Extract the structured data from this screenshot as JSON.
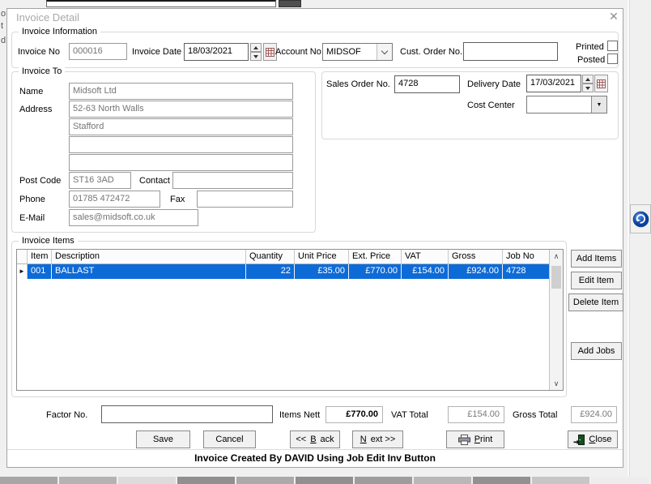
{
  "window": {
    "title": "Invoice Detail"
  },
  "icons": {
    "close": "✕",
    "row_selector": "►",
    "dropdown_arrow": "▼",
    "scroll_up": "∧",
    "scroll_down": "∨"
  },
  "colors": {
    "selection_blue": "#0d6bd8",
    "calendar_icon_brown": "#9d5b5b",
    "door_icon_green": "#17501c"
  },
  "background": {
    "clipped_letters": [
      "o",
      "t",
      "d"
    ]
  },
  "invoice_information": {
    "group_label": "Invoice Information",
    "invoice_no_label": "Invoice No",
    "invoice_no": "000016",
    "invoice_date_label": "Invoice Date",
    "invoice_date": "18/03/2021",
    "account_no_label": "Account No.",
    "account_no": "MIDSOF",
    "cust_order_no_label": "Cust. Order No.",
    "cust_order_no": "",
    "printed_label": "Printed",
    "printed_checked": false,
    "posted_label": "Posted",
    "posted_checked": false
  },
  "invoice_to": {
    "group_label": "Invoice To",
    "name_label": "Name",
    "name": "Midsoft Ltd",
    "address_label": "Address",
    "address_lines": [
      "52-63 North Walls",
      "Stafford",
      "",
      ""
    ],
    "post_code_label": "Post Code",
    "post_code": "ST16 3AD",
    "contact_label": "Contact",
    "contact": "",
    "phone_label": "Phone",
    "phone": "01785 472472",
    "fax_label": "Fax",
    "fax": "",
    "email_label": "E-Mail",
    "email": "sales@midsoft.co.uk"
  },
  "order_details": {
    "sales_order_no_label": "Sales Order No.",
    "sales_order_no": "4728",
    "delivery_date_label": "Delivery Date",
    "delivery_date": "17/03/2021",
    "cost_center_label": "Cost Center",
    "cost_center": ""
  },
  "invoice_items": {
    "group_label": "Invoice Items",
    "columns": [
      "Item",
      "Description",
      "Quantity",
      "Unit Price",
      "Ext. Price",
      "VAT",
      "Gross",
      "Job No"
    ],
    "rows": [
      {
        "item": "001",
        "description": "BALLAST",
        "quantity": "22",
        "unit_price": "£35.00",
        "ext_price": "£770.00",
        "vat": "£154.00",
        "gross": "£924.00",
        "job_no": "4728"
      }
    ],
    "buttons": {
      "add_items": "Add Items",
      "edit_item": "Edit Item",
      "delete_item": "Delete Item",
      "add_jobs": "Add Jobs"
    }
  },
  "totals": {
    "factor_no_label": "Factor No.",
    "factor_no": "",
    "items_nett_label": "Items Nett",
    "items_nett": "£770.00",
    "vat_total_label": "VAT Total",
    "vat_total": "£154.00",
    "gross_total_label": "Gross Total",
    "gross_total": "£924.00"
  },
  "actions": {
    "save": {
      "label": "Save"
    },
    "cancel": {
      "label": "Cancel"
    },
    "back": {
      "label": "<< Back",
      "accesskey": "B"
    },
    "next": {
      "label": "Next >>",
      "accesskey": "N"
    },
    "print": {
      "label": "Print",
      "accesskey": "P"
    },
    "close": {
      "label": "Close",
      "accesskey": "C"
    }
  },
  "status_bar": {
    "text": "Invoice Created By DAVID Using Job Edit Inv Button"
  }
}
